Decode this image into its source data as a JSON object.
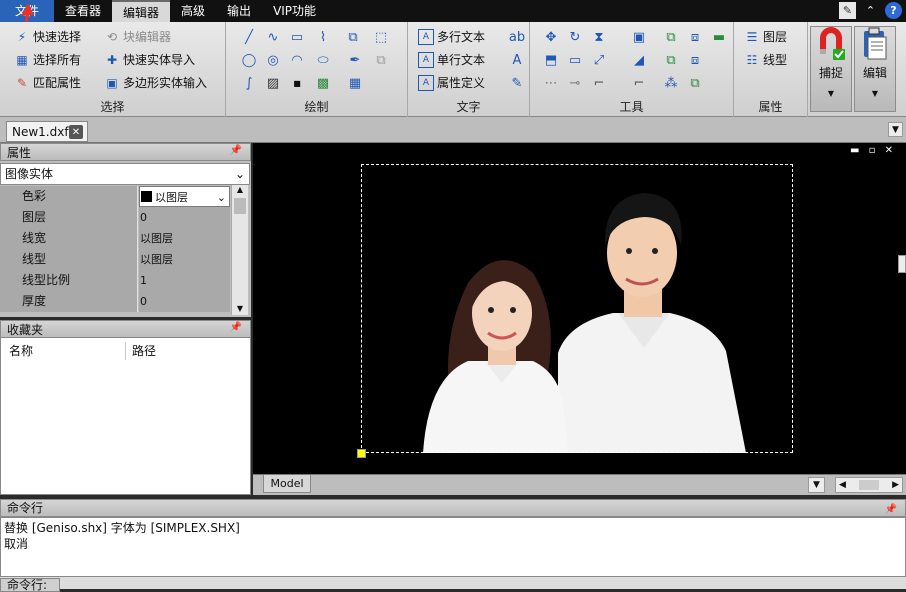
{
  "menubar": {
    "tabs": [
      "文件",
      "查看器",
      "编辑器",
      "高级",
      "输出",
      "VIP功能"
    ],
    "active": "编辑器"
  },
  "ribbon": {
    "select": {
      "title": "选择",
      "items": [
        "快速选择",
        "块编辑器",
        "选择所有",
        "快速实体导入",
        "匹配属性",
        "多边形实体输入"
      ]
    },
    "draw": {
      "title": "绘制"
    },
    "text": {
      "title": "文字",
      "items": [
        "多行文本",
        "单行文本",
        "属性定义"
      ]
    },
    "tools": {
      "title": "工具"
    },
    "properties": {
      "title": "属性",
      "items": [
        "图层",
        "线型"
      ]
    },
    "snap": "捕捉",
    "edit": "编辑"
  },
  "document": {
    "tab": "New1.dxf"
  },
  "properties_panel": {
    "title": "属性",
    "entity_type": "图像实体",
    "rows": [
      {
        "key": "色彩",
        "value": "以图层"
      },
      {
        "key": "图层",
        "value": "0"
      },
      {
        "key": "线宽",
        "value": "以图层"
      },
      {
        "key": "线型",
        "value": "以图层"
      },
      {
        "key": "线型比例",
        "value": "1"
      },
      {
        "key": "厚度",
        "value": "0"
      }
    ]
  },
  "favorites_panel": {
    "title": "收藏夹",
    "col_name": "名称",
    "col_path": "路径"
  },
  "layout": {
    "model_tab": "Model"
  },
  "command": {
    "title": "命令行",
    "lines": [
      "替换 [Geniso.shx] 字体为 [SIMPLEX.SHX]",
      "取消"
    ],
    "input_label": "命令行:"
  },
  "colors": {
    "file_tab": "#2a64b8",
    "grip": "#ffff00",
    "annotation_arrow": "#e8332a"
  }
}
